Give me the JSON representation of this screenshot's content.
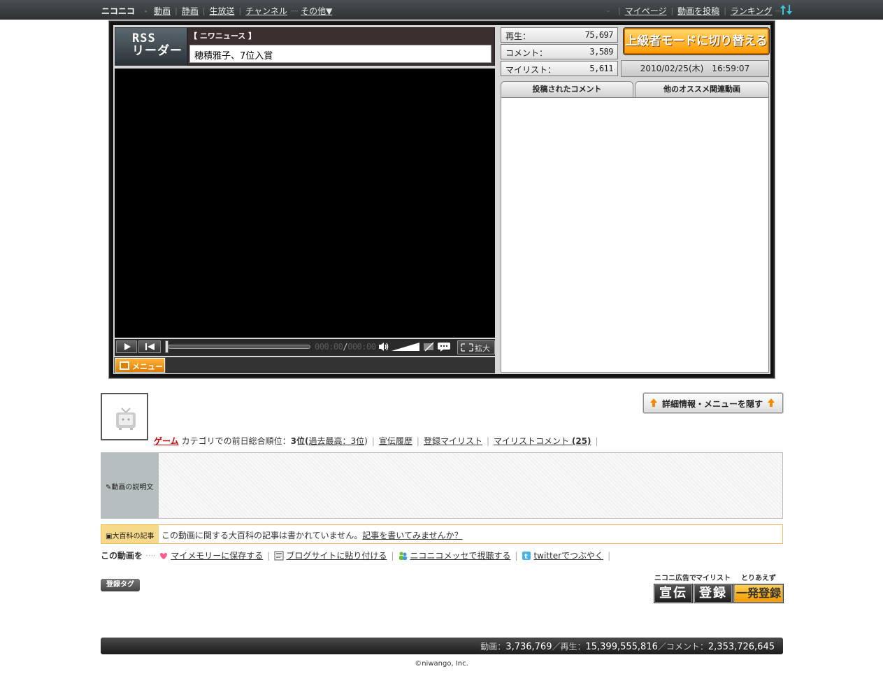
{
  "nav": {
    "brand": "ニコニコ",
    "dot": "・",
    "items": [
      "動画",
      "静画",
      "生放送",
      "チャンネル"
    ],
    "more": "その他▼",
    "right_dash": "-",
    "right_items": [
      "マイページ",
      "動画を投稿",
      "ランキング"
    ]
  },
  "rss": {
    "line1": "RSS",
    "line2": "リーダー",
    "category": "【 ニワニュース 】",
    "headline": "穂積雅子、7位入賞"
  },
  "player": {
    "time_current": "000:00",
    "time_total": "000:00",
    "time_sep": "/",
    "zoom_label": "拡大",
    "menu_label": "メニュー"
  },
  "stats": {
    "views_label": "再生：",
    "views": "75,697",
    "comments_label": "コメント：",
    "comments": "3,589",
    "mylist_label": "マイリスト：",
    "mylist": "5,611",
    "advanced_button": "上級者モードに切り替える",
    "datetime": "2010/02/25(木)　16:59:07"
  },
  "tabs": {
    "comments": "投稿されたコメント",
    "related": "他のオススメ関連動画"
  },
  "details": {
    "hide_button": "詳細情報・メニューを隠す",
    "category": "ゲーム",
    "rank_text": "カテゴリでの前日総合順位：",
    "rank": "3位(",
    "best_rank": "過去最高：3位",
    "rank_close": ")",
    "ad_history": "宣伝履歴",
    "mylist_reg": "登録マイリスト",
    "mylist_comment": "マイリストコメント",
    "mylist_comment_count": "(25)",
    "desc_label": "動画の説明文",
    "dic_label": "大百科の記事",
    "dic_text": "この動画に関する大百科の記事は書かれていません。",
    "dic_link": "記事を書いてみませんか？"
  },
  "share": {
    "lead": "この動画を",
    "items": [
      "マイメモリーに保存する",
      "ブログサイトに貼り付ける",
      "ニコニコメッセで視聴する",
      "twitterでつぶやく"
    ]
  },
  "tags": {
    "label": "登録タグ"
  },
  "ads": {
    "cap1": "ニコニ広告で",
    "btn1": "宣伝",
    "cap2": "マイリスト",
    "btn2": "登録",
    "cap3": "とりあえず",
    "btn3": "一発登録"
  },
  "footer": {
    "videos_label": "動画：",
    "videos": "3,736,769",
    "views_label": "／再生：",
    "views": "15,399,555,816",
    "comments_label": "／コメント：",
    "comments": "2,353,726,645",
    "copyright": "©niwango, Inc."
  },
  "colors": {
    "accent_orange": "#ff9900",
    "category_red": "#cc0000",
    "dark_frame": "#111111"
  }
}
